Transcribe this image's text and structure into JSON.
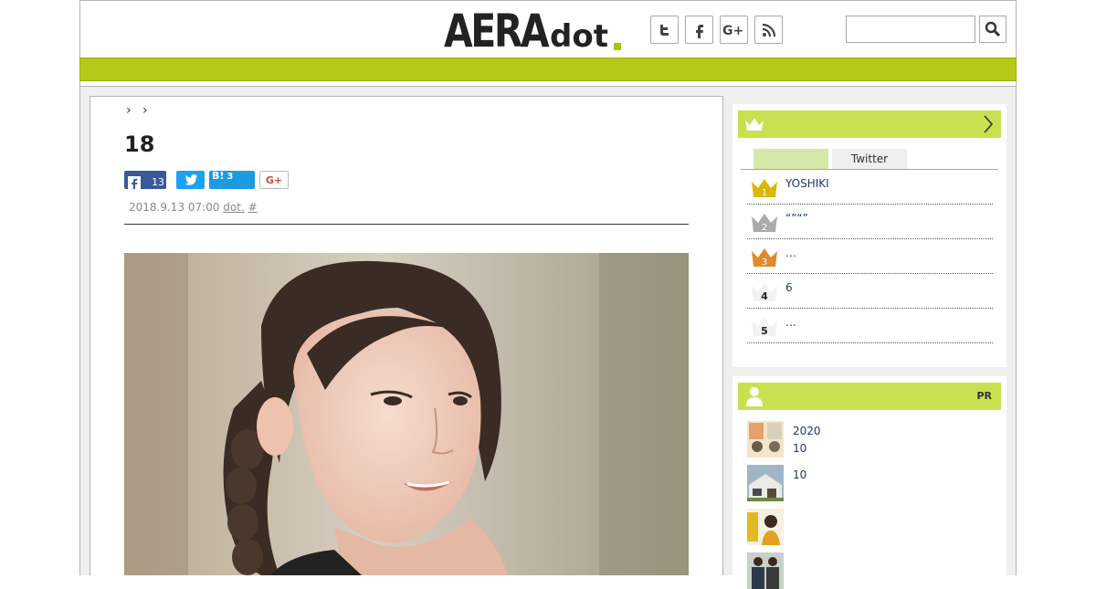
{
  "header": {
    "logo_main": "AERA",
    "logo_sub": "dot",
    "social": [
      "twitter-icon",
      "facebook-icon",
      "google-plus-icon",
      "rss-icon"
    ],
    "search_placeholder": "",
    "accent_color": "#b4c818"
  },
  "article": {
    "breadcrumb": "› ›",
    "title": "18",
    "share": {
      "facebook_count": "13",
      "hatena_label": "B!",
      "hatena_count": "3",
      "gplus_label": "G+"
    },
    "meta": {
      "date": "2018.9.13 07:00",
      "source": "dot.",
      "hash": "#"
    }
  },
  "ranking": {
    "tabs": [
      "",
      "Twitter"
    ],
    "items": [
      {
        "rank": "1",
        "text": "YOSHIKI",
        "color": "#d9b800"
      },
      {
        "rank": "2",
        "text": "“”“”",
        "color": "#aaaaaa"
      },
      {
        "rank": "3",
        "text": "…",
        "color": "#e08a2a"
      },
      {
        "rank": "4",
        "text": "6",
        "color": "#ffffff"
      },
      {
        "rank": "5",
        "text": "…",
        "color": "#ffffff"
      }
    ]
  },
  "pr": {
    "label": "PR",
    "items": [
      {
        "line1": "2020",
        "line2": "10"
      },
      {
        "line1": "10",
        "line2": ""
      },
      {
        "line1": "",
        "line2": ""
      },
      {
        "line1": "",
        "line2": ""
      }
    ]
  }
}
